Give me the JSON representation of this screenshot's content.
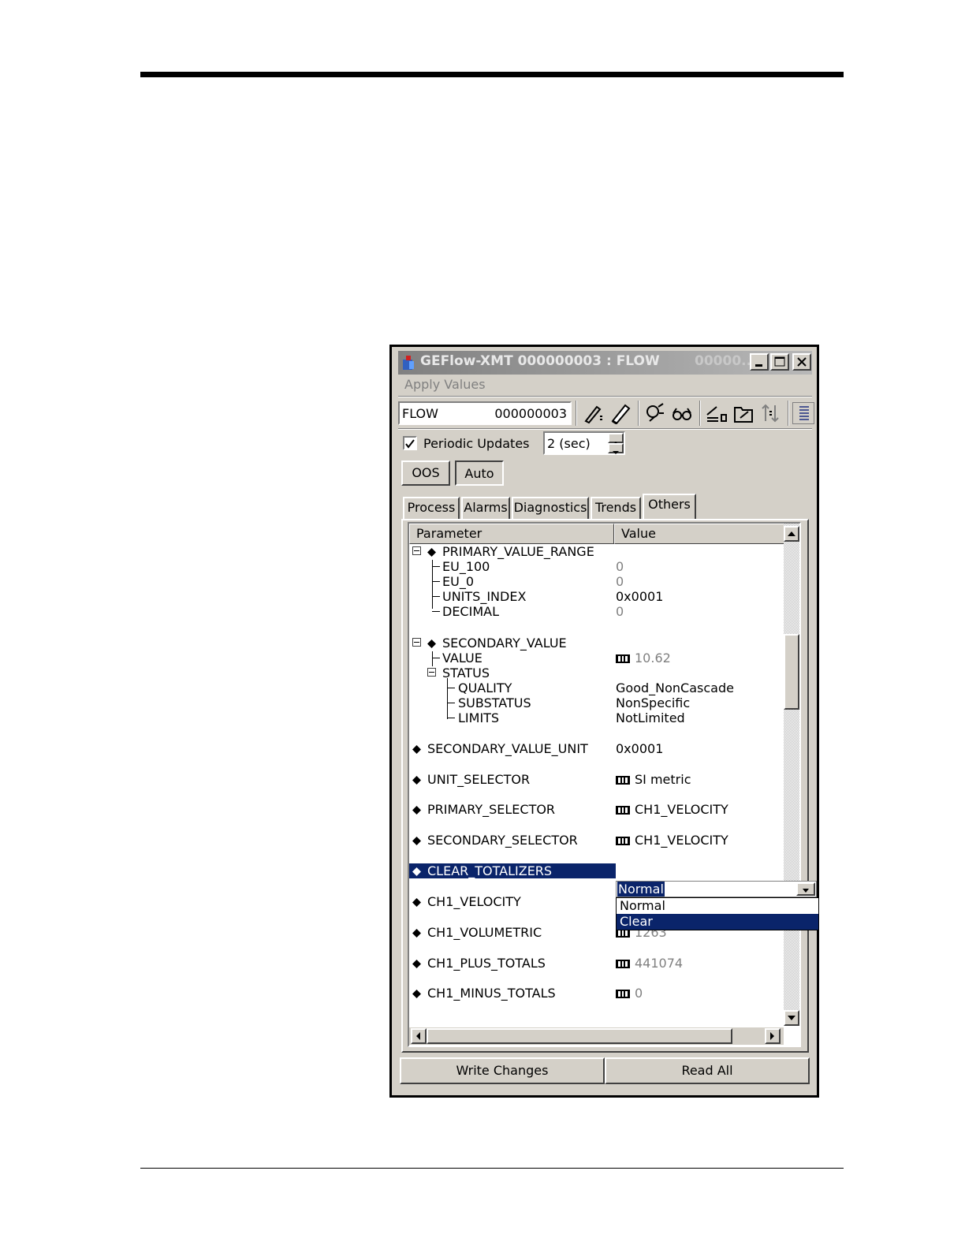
{
  "window": {
    "title": "GEFlow-XMT  000000003 : FLOW",
    "title_tail": "00000...",
    "menu": "Apply Values"
  },
  "toolbar": {
    "tag": "FLOW",
    "device_id": "000000003",
    "icons": [
      "edit-icon",
      "pencil-icon",
      "compare-icon",
      "glasses-icon",
      "write-icon",
      "folder-icon",
      "arrows-icon",
      "list-icon"
    ]
  },
  "periodic": {
    "label": "Periodic Updates",
    "checked": true,
    "interval": "2 (sec)"
  },
  "mode_buttons": {
    "oos": "OOS",
    "auto": "Auto"
  },
  "tabs": [
    "Process",
    "Alarms",
    "Diagnostics",
    "Trends",
    "Others"
  ],
  "active_tab": "Others",
  "grid": {
    "col_param": "Parameter",
    "col_value": "Value",
    "rows": [
      {
        "param": "PRIMARY_VALUE_RANGE",
        "value": ""
      },
      {
        "param": "EU_100",
        "value": "0"
      },
      {
        "param": "EU_0",
        "value": "0"
      },
      {
        "param": "UNITS_INDEX",
        "value": "0x0001"
      },
      {
        "param": "DECIMAL",
        "value": "0"
      },
      {
        "param": "SECONDARY_VALUE",
        "value": ""
      },
      {
        "param": "VALUE",
        "value": "10.62"
      },
      {
        "param": "STATUS",
        "value": ""
      },
      {
        "param": "QUALITY",
        "value": "Good_NonCascade"
      },
      {
        "param": "SUBSTATUS",
        "value": "NonSpecific"
      },
      {
        "param": "LIMITS",
        "value": "NotLimited"
      },
      {
        "param": "SECONDARY_VALUE_UNIT",
        "value": "0x0001"
      },
      {
        "param": "UNIT_SELECTOR",
        "value": "SI metric"
      },
      {
        "param": "PRIMARY_SELECTOR",
        "value": "CH1_VELOCITY"
      },
      {
        "param": "SECONDARY_SELECTOR",
        "value": "CH1_VELOCITY"
      },
      {
        "param": "CLEAR_TOTALIZERS",
        "value": "Normal"
      },
      {
        "param": "CH1_VELOCITY",
        "value": ""
      },
      {
        "param": "CH1_VOLUMETRIC",
        "value": "1263"
      },
      {
        "param": "CH1_PLUS_TOTALS",
        "value": "441074"
      },
      {
        "param": "CH1_MINUS_TOTALS",
        "value": "0"
      }
    ],
    "dropdown_options": [
      "Normal",
      "Clear"
    ],
    "dropdown_highlight": "Clear"
  },
  "buttons": {
    "write": "Write Changes",
    "read": "Read All"
  },
  "colors": {
    "selection": "#0a246a",
    "face": "#d4d0c8"
  }
}
